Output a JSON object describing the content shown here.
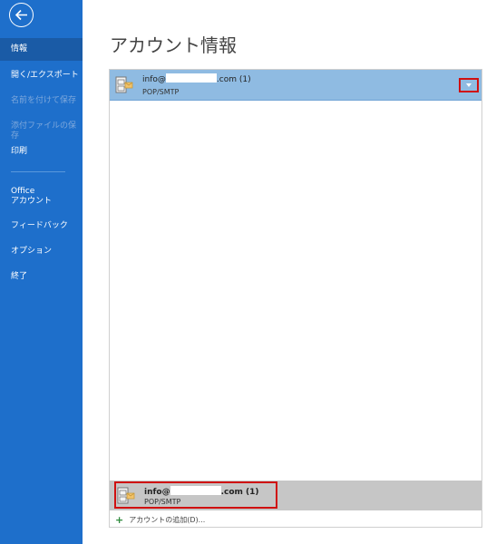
{
  "sidebar": {
    "back_icon": "back-arrow-icon",
    "items": [
      {
        "label": "情報"
      },
      {
        "label": "開く/エクスポート"
      },
      {
        "label": "名前を付けて保存"
      },
      {
        "label": "添付ファイルの保存"
      },
      {
        "label": "印刷"
      },
      {
        "label_line1": "Office",
        "label_line2": "アカウント"
      },
      {
        "label": "フィードバック"
      },
      {
        "label": "オプション"
      },
      {
        "label": "終了"
      }
    ]
  },
  "main": {
    "title": "アカウント情報",
    "selected_account": {
      "email_prefix": "info@",
      "email_suffix": ".com (1)",
      "type": "POP/SMTP"
    },
    "list_account": {
      "email_prefix": "info@",
      "email_suffix": ".com (1)",
      "type": "POP/SMTP"
    },
    "add_account": {
      "plus": "+",
      "label": "アカウントの追加(D)..."
    }
  },
  "colors": {
    "sidebar": "#1e6fcb",
    "selected_header": "#8fbbe2",
    "list_item": "#c6c6c6",
    "highlight": "#d01010"
  }
}
